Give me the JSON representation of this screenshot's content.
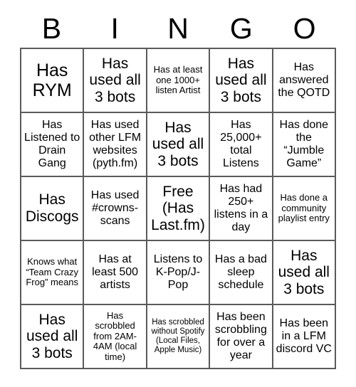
{
  "header": {
    "letters": [
      "B",
      "I",
      "N",
      "G",
      "O"
    ]
  },
  "grid": {
    "rows": [
      [
        {
          "text": "Has RYM",
          "size": "xl"
        },
        {
          "text": "Has used all 3 bots",
          "size": "lg"
        },
        {
          "text": "Has at least one 1000+ listen Artist",
          "size": "sm"
        },
        {
          "text": "Has used all 3 bots",
          "size": "lg"
        },
        {
          "text": "Has answered the QOTD",
          "size": "md"
        }
      ],
      [
        {
          "text": "Has Listened to Drain Gang",
          "size": "md"
        },
        {
          "text": "Has used other LFM websites (pyth.fm)",
          "size": "md"
        },
        {
          "text": "Has used all 3 bots",
          "size": "lg"
        },
        {
          "text": "Has 25,000+ total Listens",
          "size": "md"
        },
        {
          "text": "Has done the “Jumble Game”",
          "size": "md"
        }
      ],
      [
        {
          "text": "Has Discogs",
          "size": "lg"
        },
        {
          "text": "Has used #crowns-scans",
          "size": "md"
        },
        {
          "text": "Free (Has Last.fm)",
          "size": "lg"
        },
        {
          "text": "Has had 250+ listens in a day",
          "size": "md"
        },
        {
          "text": "Has done a community playlist entry",
          "size": "sm"
        }
      ],
      [
        {
          "text": "Knows what “Team Crazy Frog” means",
          "size": "sm"
        },
        {
          "text": "Has at least 500 artists",
          "size": "md"
        },
        {
          "text": "Listens to K-Pop/J-Pop",
          "size": "md"
        },
        {
          "text": "Has a bad sleep schedule",
          "size": "md"
        },
        {
          "text": "Has used all 3 bots",
          "size": "lg"
        }
      ],
      [
        {
          "text": "Has used all 3 bots",
          "size": "lg"
        },
        {
          "text": "Has scrobbled from 2AM-4AM (local time)",
          "size": "sm"
        },
        {
          "text": "Has scrobbled without Spotify (Local Files, Apple Music)",
          "size": "xs"
        },
        {
          "text": "Has been scrobbling for over a year",
          "size": "md"
        },
        {
          "text": "Has been in a LFM discord VC",
          "size": "md"
        }
      ]
    ]
  },
  "colors": {
    "border": "#5a5a5a",
    "text": "#000000",
    "background": "#ffffff"
  }
}
